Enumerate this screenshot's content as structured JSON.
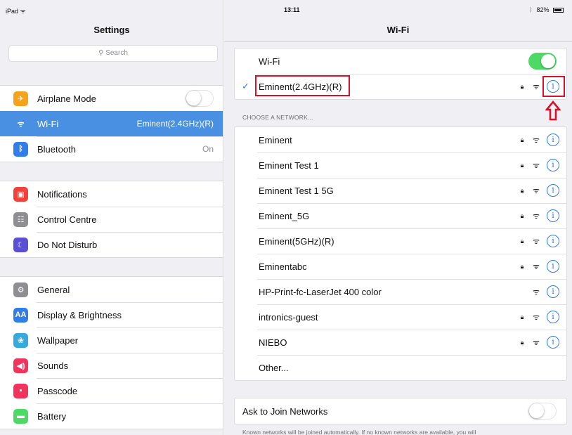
{
  "status_bar": {
    "device": "iPad",
    "wifi_glyph": "ᯤ",
    "time": "13:11",
    "bt_glyph": "ᛒ",
    "battery": "82%"
  },
  "left": {
    "title": "Settings",
    "search_placeholder": "Search",
    "groups": [
      [
        {
          "label": "Airplane Mode",
          "icon": "airplane-icon",
          "glyph": "✈",
          "color": "#f7a21b",
          "toggle": "off"
        },
        {
          "label": "Wi-Fi",
          "icon": "wifi-icon",
          "glyph": "ᯤ",
          "color": "#2f7ee9",
          "value": "Eminent(2.4GHz)(R)",
          "selected": true
        },
        {
          "label": "Bluetooth",
          "icon": "bluetooth-icon",
          "glyph": "ᛒ",
          "color": "#2f7ee9",
          "value": "On"
        }
      ],
      [
        {
          "label": "Notifications",
          "icon": "notifications-icon",
          "glyph": "▣",
          "color": "#f2413a"
        },
        {
          "label": "Control Centre",
          "icon": "control-centre-icon",
          "glyph": "☷",
          "color": "#8e8e93"
        },
        {
          "label": "Do Not Disturb",
          "icon": "moon-icon",
          "glyph": "☾",
          "color": "#5b4fd6"
        }
      ],
      [
        {
          "label": "General",
          "icon": "gear-icon",
          "glyph": "⚙",
          "color": "#8e8e93"
        },
        {
          "label": "Display & Brightness",
          "icon": "display-brightness-icon",
          "glyph": "AA",
          "color": "#2f7ee9"
        },
        {
          "label": "Wallpaper",
          "icon": "wallpaper-icon",
          "glyph": "❀",
          "color": "#35aadc"
        },
        {
          "label": "Sounds",
          "icon": "speaker-icon",
          "glyph": "◀)",
          "color": "#f2345d"
        },
        {
          "label": "Passcode",
          "icon": "lock-icon",
          "glyph": "▪",
          "color": "#f2345d"
        },
        {
          "label": "Battery",
          "icon": "battery-icon",
          "glyph": "▬",
          "color": "#4cd964"
        }
      ]
    ]
  },
  "right": {
    "title": "Wi-Fi",
    "wifi_label": "Wi-Fi",
    "wifi_on": true,
    "connected": {
      "name": "Eminent(2.4GHz)(R)",
      "check_glyph": "✓",
      "secured": true
    },
    "section_caption": "CHOOSE A NETWORK...",
    "lock_glyph": "🔒︎",
    "wifi_glyph": "ᯤ",
    "info_glyph": "i",
    "networks": [
      {
        "name": "Eminent",
        "secured": true
      },
      {
        "name": "Eminent Test 1",
        "secured": true
      },
      {
        "name": "Eminent Test 1 5G",
        "secured": true
      },
      {
        "name": "Eminent_5G",
        "secured": true
      },
      {
        "name": "Eminent(5GHz)(R)",
        "secured": true
      },
      {
        "name": "Eminentabc",
        "secured": true
      },
      {
        "name": "HP-Print-fc-LaserJet 400 color",
        "secured": false
      },
      {
        "name": "intronics-guest",
        "secured": true
      },
      {
        "name": "NIEBO",
        "secured": true
      }
    ],
    "other_label": "Other...",
    "ask_to_join_label": "Ask to Join Networks",
    "ask_to_join_on": false,
    "footer_note": "Known networks will be joined automatically. If no known networks are available, you will"
  },
  "colors": {
    "accent": "#2f7ee9",
    "toggle_on": "#4cd964",
    "annotation_red": "#d6122a",
    "selected_row": "#4a90e2"
  }
}
